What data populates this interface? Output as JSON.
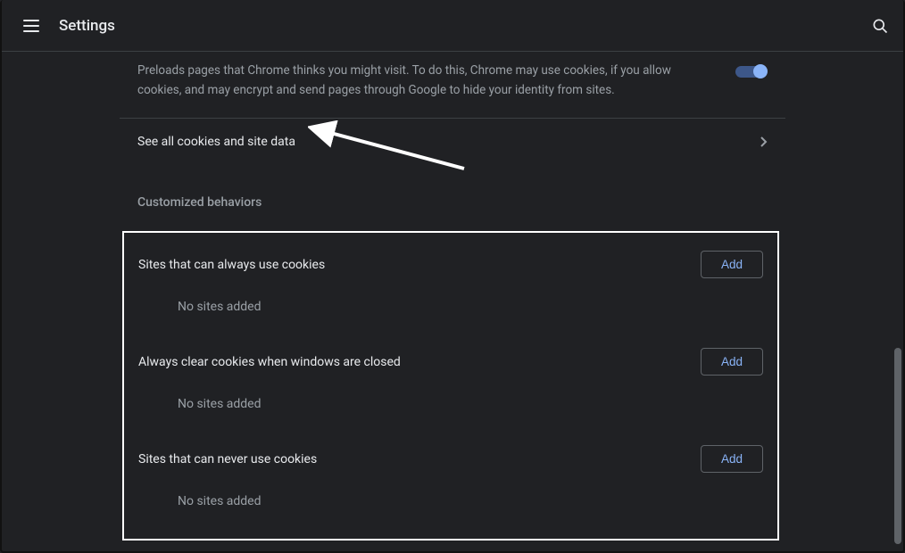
{
  "header": {
    "title": "Settings"
  },
  "preload": {
    "description": "Preloads pages that Chrome thinks you might visit. To do this, Chrome may use cookies, if you allow cookies, and may encrypt and send pages through Google to hide your identity from sites.",
    "toggle_on": true
  },
  "see_all": {
    "label": "See all cookies and site data"
  },
  "behaviors": {
    "section_title": "Customized behaviors",
    "blocks": [
      {
        "title": "Sites that can always use cookies",
        "add_label": "Add",
        "empty": "No sites added"
      },
      {
        "title": "Always clear cookies when windows are closed",
        "add_label": "Add",
        "empty": "No sites added"
      },
      {
        "title": "Sites that can never use cookies",
        "add_label": "Add",
        "empty": "No sites added"
      }
    ]
  }
}
